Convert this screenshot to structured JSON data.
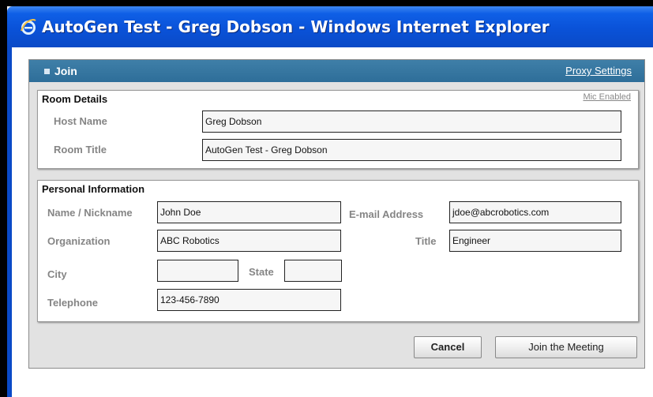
{
  "window": {
    "title": "AutoGen Test - Greg Dobson - Windows Internet Explorer",
    "icon": "ie-icon"
  },
  "dialog": {
    "header_title": "Join",
    "proxy_settings_label": "Proxy Settings"
  },
  "room_details": {
    "section_title": "Room Details",
    "mic_status": "Mic Enabled",
    "host_name_label": "Host Name",
    "host_name_value": "Greg Dobson",
    "room_title_label": "Room Title",
    "room_title_value": "AutoGen Test - Greg Dobson"
  },
  "personal_info": {
    "section_title": "Personal Information",
    "name_label": "Name / Nickname",
    "name_value": "John Doe",
    "email_label": "E-mail Address",
    "email_value": "jdoe@abcrobotics.com",
    "organization_label": "Organization",
    "organization_value": "ABC Robotics",
    "title_label": "Title",
    "title_value": "Engineer",
    "city_label": "City",
    "city_value": "",
    "state_label": "State",
    "state_value": "",
    "telephone_label": "Telephone",
    "telephone_value": "123-456-7890"
  },
  "buttons": {
    "cancel_label": "Cancel",
    "join_label": "Join the Meeting"
  },
  "colors": {
    "titlebar": "#0a52d8",
    "dialog_header": "#2e6e99",
    "label_gray": "#858585"
  }
}
